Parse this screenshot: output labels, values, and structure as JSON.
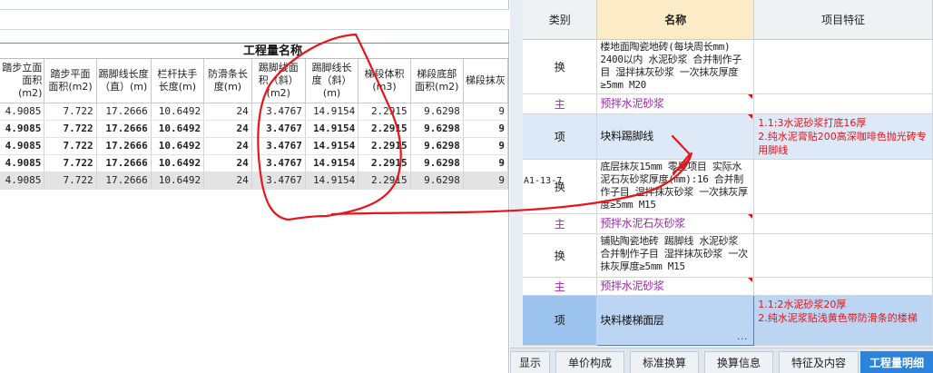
{
  "quantities": {
    "group_title": "工程量名称",
    "columns": [
      "踏步立面面积(m2)",
      "踏步平面面积(m2)",
      "踢脚线长度（直）(m)",
      "栏杆扶手长度(m)",
      "防滑条长度(m)",
      "踢脚线面积（斜）(m2)",
      "踢脚线长度（斜）(m)",
      "梯段体积(m3)",
      "梯段底部面积(m2)",
      "梯段抹灰"
    ],
    "rows": [
      [
        "4.9085",
        "7.722",
        "17.2666",
        "10.6492",
        "24",
        "3.4767",
        "14.9154",
        "2.2915",
        "9.6298",
        "9"
      ],
      [
        "4.9085",
        "7.722",
        "17.2666",
        "10.6492",
        "24",
        "3.4767",
        "14.9154",
        "2.2915",
        "9.6298",
        "9"
      ],
      [
        "4.9085",
        "7.722",
        "17.2666",
        "10.6492",
        "24",
        "3.4767",
        "14.9154",
        "2.2915",
        "9.6298",
        "9"
      ],
      [
        "4.9085",
        "7.722",
        "17.2666",
        "10.6492",
        "24",
        "3.4767",
        "14.9154",
        "2.2915",
        "9.6298",
        "9"
      ],
      [
        "4.9085",
        "7.722",
        "17.2666",
        "10.6492",
        "24",
        "3.4767",
        "14.9154",
        "2.2915",
        "9.6298",
        "9"
      ]
    ]
  },
  "side_code": "A1-13-7",
  "items": {
    "headers": {
      "kind": "类别",
      "name": "名称",
      "feature": "项目特征"
    },
    "rows": [
      {
        "kind": "换",
        "name": "楼地面陶瓷地砖(每块周长mm) 2400以内 水泥砂浆 合并制作子目 湿拌抹灰砂浆 一次抹灰厚度≥5mm M20",
        "feature": ""
      },
      {
        "kind": "主",
        "name": "预拌水泥砂浆",
        "feature": ""
      },
      {
        "kind": "项",
        "name": "块料踢脚线",
        "feature": "1.1:3水泥砂浆打底16厚\n2.纯水泥膏贴200高深咖啡色抛光砖专用脚线"
      },
      {
        "kind": "换",
        "name": "底层抹灰15mm 零星项目 实际水泥石灰砂浆厚度(mm):16 合并制作子目 湿拌抹灰砂浆 一次抹灰厚度≥5mm M15",
        "feature": ""
      },
      {
        "kind": "主",
        "name": "预拌水泥石灰砂浆",
        "feature": ""
      },
      {
        "kind": "换",
        "name": "铺贴陶瓷地砖 踢脚线 水泥砂浆 合并制作子目 湿拌抹灰砂浆 一次抹灰厚度≥5mm M15",
        "feature": ""
      },
      {
        "kind": "主",
        "name": "预拌水泥砂浆",
        "feature": ""
      },
      {
        "kind": "项",
        "name": "块料楼梯面层",
        "feature": "1.1:2水泥砂浆20厚\n2.纯水泥浆贴浅黄色带防滑条的楼梯"
      }
    ],
    "ellipsis": "..."
  },
  "tabs": [
    "显示",
    "单价构成",
    "标准换算",
    "换算信息",
    "特征及内容",
    "工程量明细"
  ],
  "active_tab": "工程量明细",
  "colors": {
    "accent": "#2a84dd",
    "feature_text": "#e2141a",
    "main_material": "#a026a6",
    "annotation": "#e8141c"
  }
}
